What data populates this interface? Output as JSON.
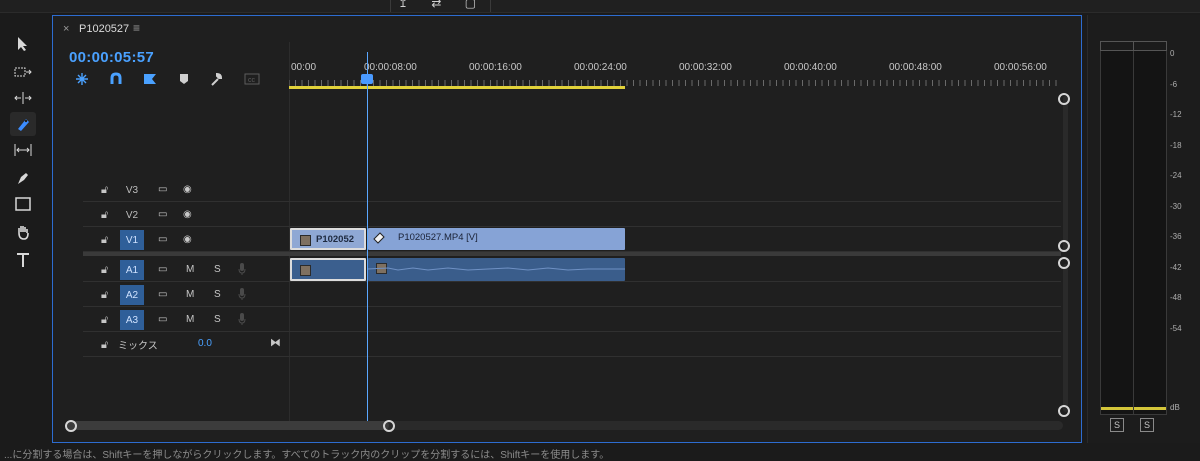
{
  "window": {
    "top_icons": "↥ ⇄ ▢"
  },
  "panel": {
    "close_glyph": "×",
    "title": "P1020527",
    "menu_glyph": "≡",
    "timecode": "00:00:05:57"
  },
  "ruler": {
    "ticks": [
      "00:00",
      "00:00:08:00",
      "00:00:16:00",
      "00:00:24:00",
      "00:00:32:00",
      "00:00:40:00",
      "00:00:48:00",
      "00:00:56:00"
    ]
  },
  "tracks": {
    "video": [
      {
        "name": "V3",
        "targeted": false
      },
      {
        "name": "V2",
        "targeted": false
      },
      {
        "name": "V1",
        "targeted": true
      }
    ],
    "audio": [
      {
        "name": "A1",
        "m": "M",
        "s": "S"
      },
      {
        "name": "A2",
        "m": "M",
        "s": "S"
      },
      {
        "name": "A3",
        "m": "M",
        "s": "S"
      }
    ],
    "mix_label": "ミックス",
    "mix_value": "0.0"
  },
  "clips": {
    "v1_selected": "P102052",
    "v1_main": "P1020527.MP4 [V]"
  },
  "meter": {
    "db_labels": [
      "0",
      "-6",
      "-12",
      "-18",
      "-24",
      "-30",
      "-36",
      "-42",
      "-48",
      "-54",
      "dB"
    ],
    "solo_left": "S",
    "solo_right": "S"
  },
  "status": "...に分割する場合は、Shiftキーを押しながらクリックします。すべてのトラック内のクリップを分割するには、Shiftキーを使用します。",
  "colors": {
    "accent": "#4aa1ff",
    "work_area": "#e2d23a",
    "clip_video": "#86a3d6",
    "clip_audio": "#3a5d8b"
  }
}
